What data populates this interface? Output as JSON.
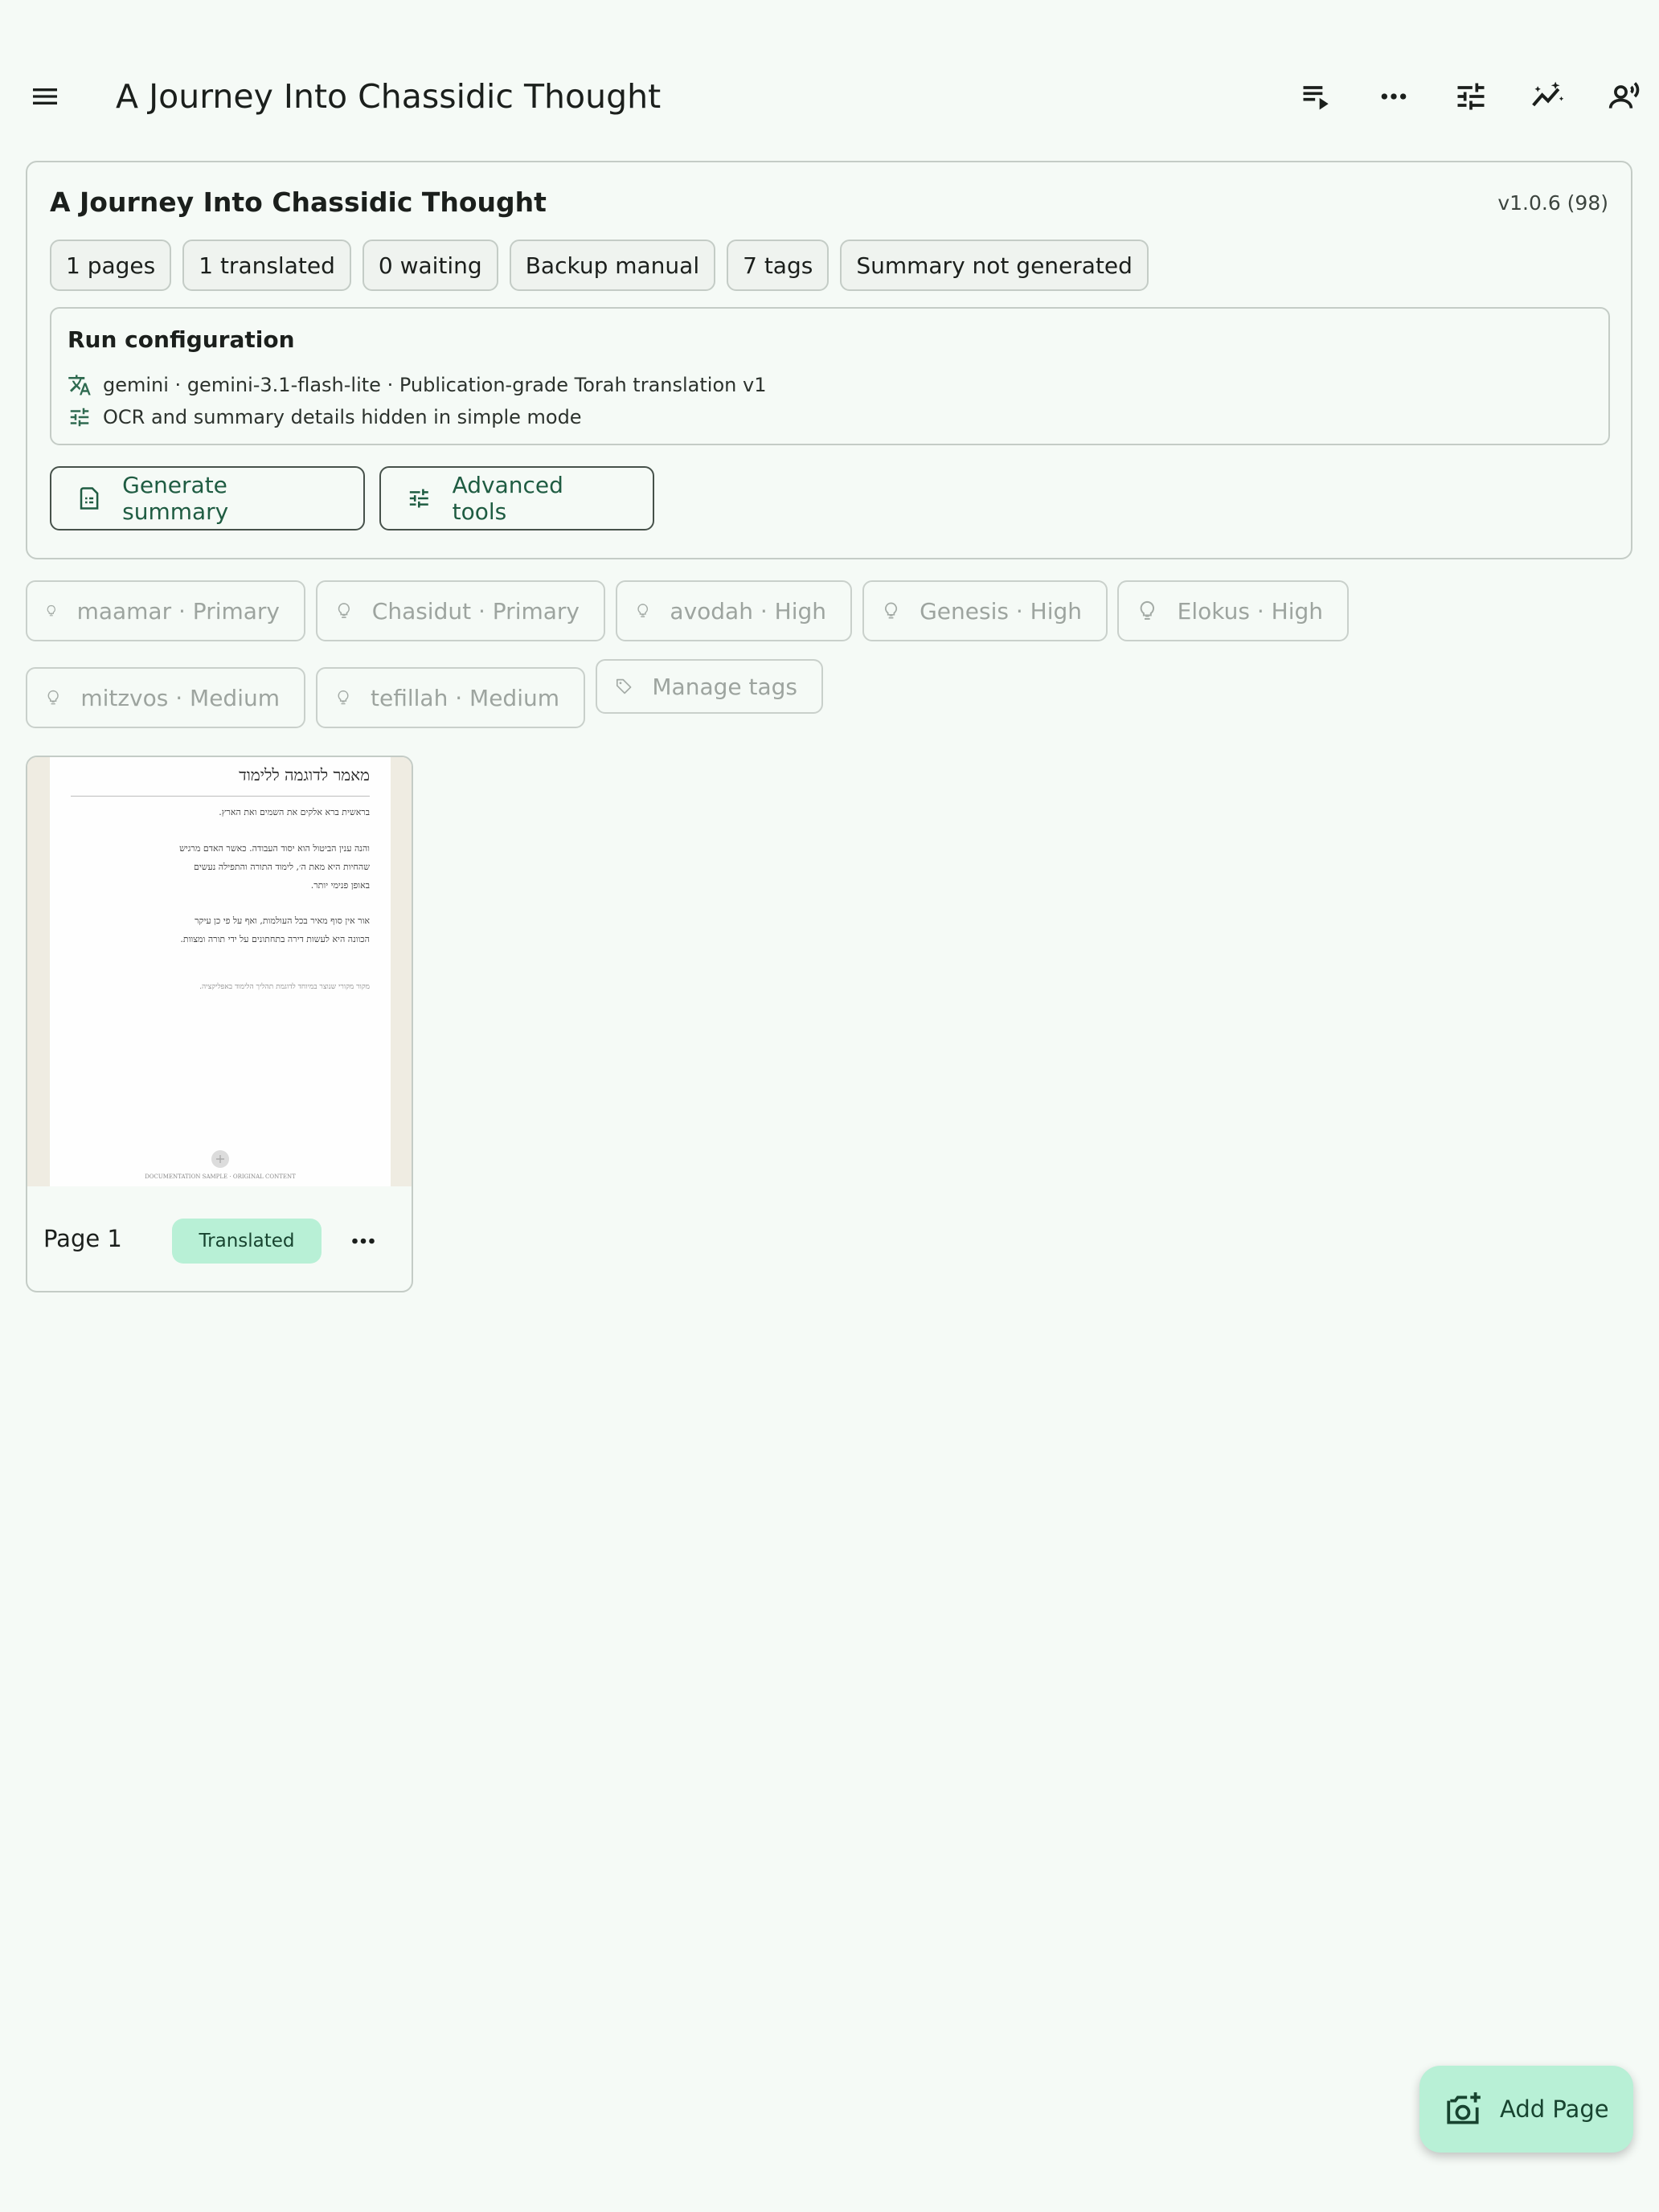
{
  "appbar": {
    "title": "A Journey Into Chassidic Thought",
    "icons": [
      "menu-icon",
      "playlist-play-icon",
      "more-horizontal-icon",
      "tune-icon",
      "magic-wand-icon",
      "voice-icon"
    ]
  },
  "summary_card": {
    "title": "A Journey Into Chassidic Thought",
    "version": "v1.0.6 (98)",
    "chips": [
      "1 pages",
      "1 translated",
      "0 waiting",
      "Backup manual",
      "7 tags",
      "Summary not generated"
    ],
    "run_config": {
      "title": "Run configuration",
      "model_line": "gemini · gemini-3.1-flash-lite · Publication-grade Torah translation v1",
      "details_line": "OCR and summary details hidden in simple mode"
    },
    "buttons": {
      "generate_summary": "Generate summary",
      "advanced_tools": "Advanced tools"
    }
  },
  "tags": [
    "maamar · Primary",
    "Chasidut · Primary",
    "avodah · High",
    "Genesis · High",
    "Elokus · High",
    "mitzvos · Medium",
    "tefillah · Medium"
  ],
  "manage_tags_label": "Manage tags",
  "page_card": {
    "thumbnail": {
      "heading": "מאמר לדוגמה ללימוד",
      "lines": [
        "בראשית ברא אלקים את השמים ואת הארץ.",
        "והנה ענין הביטול הוא יסוד העבודה. כאשר האדם מרגיש",
        "שהחיות היא מאת ה׳, לימוד התורה והתפילה נעשים",
        "באופן פנימי יותר.",
        "אור אין סוף מאיר בכל העולמות, ואף על פי כן עיקר",
        "הכוונה היא לעשות דירה בתחתונים על ידי תורה ומצוות.",
        "מקור מקורי שנוצר במיוחד לדוגמת תהליך הלימוד באפליקציה."
      ],
      "footer": "DOCUMENTATION SAMPLE · ORIGINAL CONTENT"
    },
    "label": "Page 1",
    "status": "Translated"
  },
  "fab": {
    "label": "Add Page"
  },
  "colors": {
    "background": "#f5faf6",
    "accent_green": "#b8f0d6",
    "accent_text": "#1f5c42",
    "border": "#c4ccc6"
  }
}
